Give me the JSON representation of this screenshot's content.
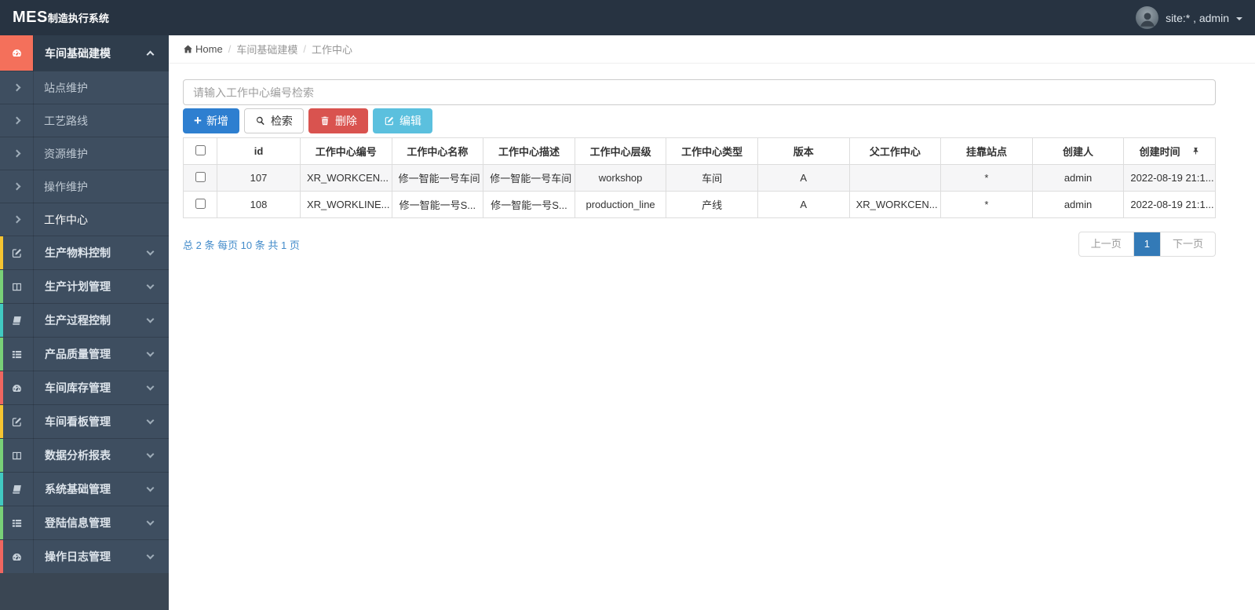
{
  "navbar": {
    "logo_bold": "MES",
    "logo_rest": "制造执行系统",
    "user_label": "site:* , admin"
  },
  "breadcrumb": {
    "home": "Home",
    "separator": "/",
    "level1": "车间基础建模",
    "level2": "工作中心"
  },
  "sidebar": {
    "active_group": {
      "label": "车间基础建模",
      "icon": "dashboard-icon"
    },
    "submenu": [
      {
        "label": "站点维护",
        "active": false
      },
      {
        "label": "工艺路线",
        "active": false
      },
      {
        "label": "资源维护",
        "active": false
      },
      {
        "label": "操作维护",
        "active": false
      },
      {
        "label": "工作中心",
        "active": true
      }
    ],
    "groups": [
      {
        "label": "生产物料控制",
        "icon": "edit-icon",
        "strip": "#f5c431"
      },
      {
        "label": "生产计划管理",
        "icon": "columns-icon",
        "strip": "#79d077"
      },
      {
        "label": "生产过程控制",
        "icon": "book-icon",
        "strip": "#41c9c1"
      },
      {
        "label": "产品质量管理",
        "icon": "list-icon",
        "strip": "#79d077"
      },
      {
        "label": "车间库存管理",
        "icon": "dashboard-icon",
        "strip": "#ef6660"
      },
      {
        "label": "车间看板管理",
        "icon": "edit-icon",
        "strip": "#f5c431"
      },
      {
        "label": "数据分析报表",
        "icon": "columns-icon",
        "strip": "#79d077"
      },
      {
        "label": "系统基础管理",
        "icon": "book-icon",
        "strip": "#41c9c1"
      },
      {
        "label": "登陆信息管理",
        "icon": "list-icon",
        "strip": "#79d077"
      },
      {
        "label": "操作日志管理",
        "icon": "dashboard-icon",
        "strip": "#ef6660"
      }
    ]
  },
  "toolbar": {
    "search_placeholder": "请输入工作中心编号检索",
    "add_label": "新增",
    "search_label": "检索",
    "delete_label": "删除",
    "edit_label": "编辑"
  },
  "table": {
    "headers": [
      "id",
      "工作中心编号",
      "工作中心名称",
      "工作中心描述",
      "工作中心层级",
      "工作中心类型",
      "版本",
      "父工作中心",
      "挂靠站点",
      "创建人",
      "创建时间"
    ],
    "rows": [
      [
        "107",
        "XR_WORKCEN...",
        "修一智能一号车间",
        "修一智能一号车间",
        "workshop",
        "车间",
        "A",
        "",
        "*",
        "admin",
        "2022-08-19 21:1..."
      ],
      [
        "108",
        "XR_WORKLINE...",
        "修一智能一号S...",
        "修一智能一号S...",
        "production_line",
        "产线",
        "A",
        "XR_WORKCEN...",
        "*",
        "admin",
        "2022-08-19 21:1..."
      ]
    ]
  },
  "pagination": {
    "summary": "总 2 条 每页 10 条 共 1 页",
    "prev_label": "上一页",
    "page_label": "1",
    "next_label": "下一页"
  },
  "colors": {
    "active_icon_block": "#f4705b",
    "add_button": "#2e7fd0",
    "delete_button": "#d9534f",
    "edit_button": "#5bc0de",
    "pagination_active_bg": "#337ab7",
    "pagination_active_border": "#337ab7",
    "link": "#428bca"
  }
}
